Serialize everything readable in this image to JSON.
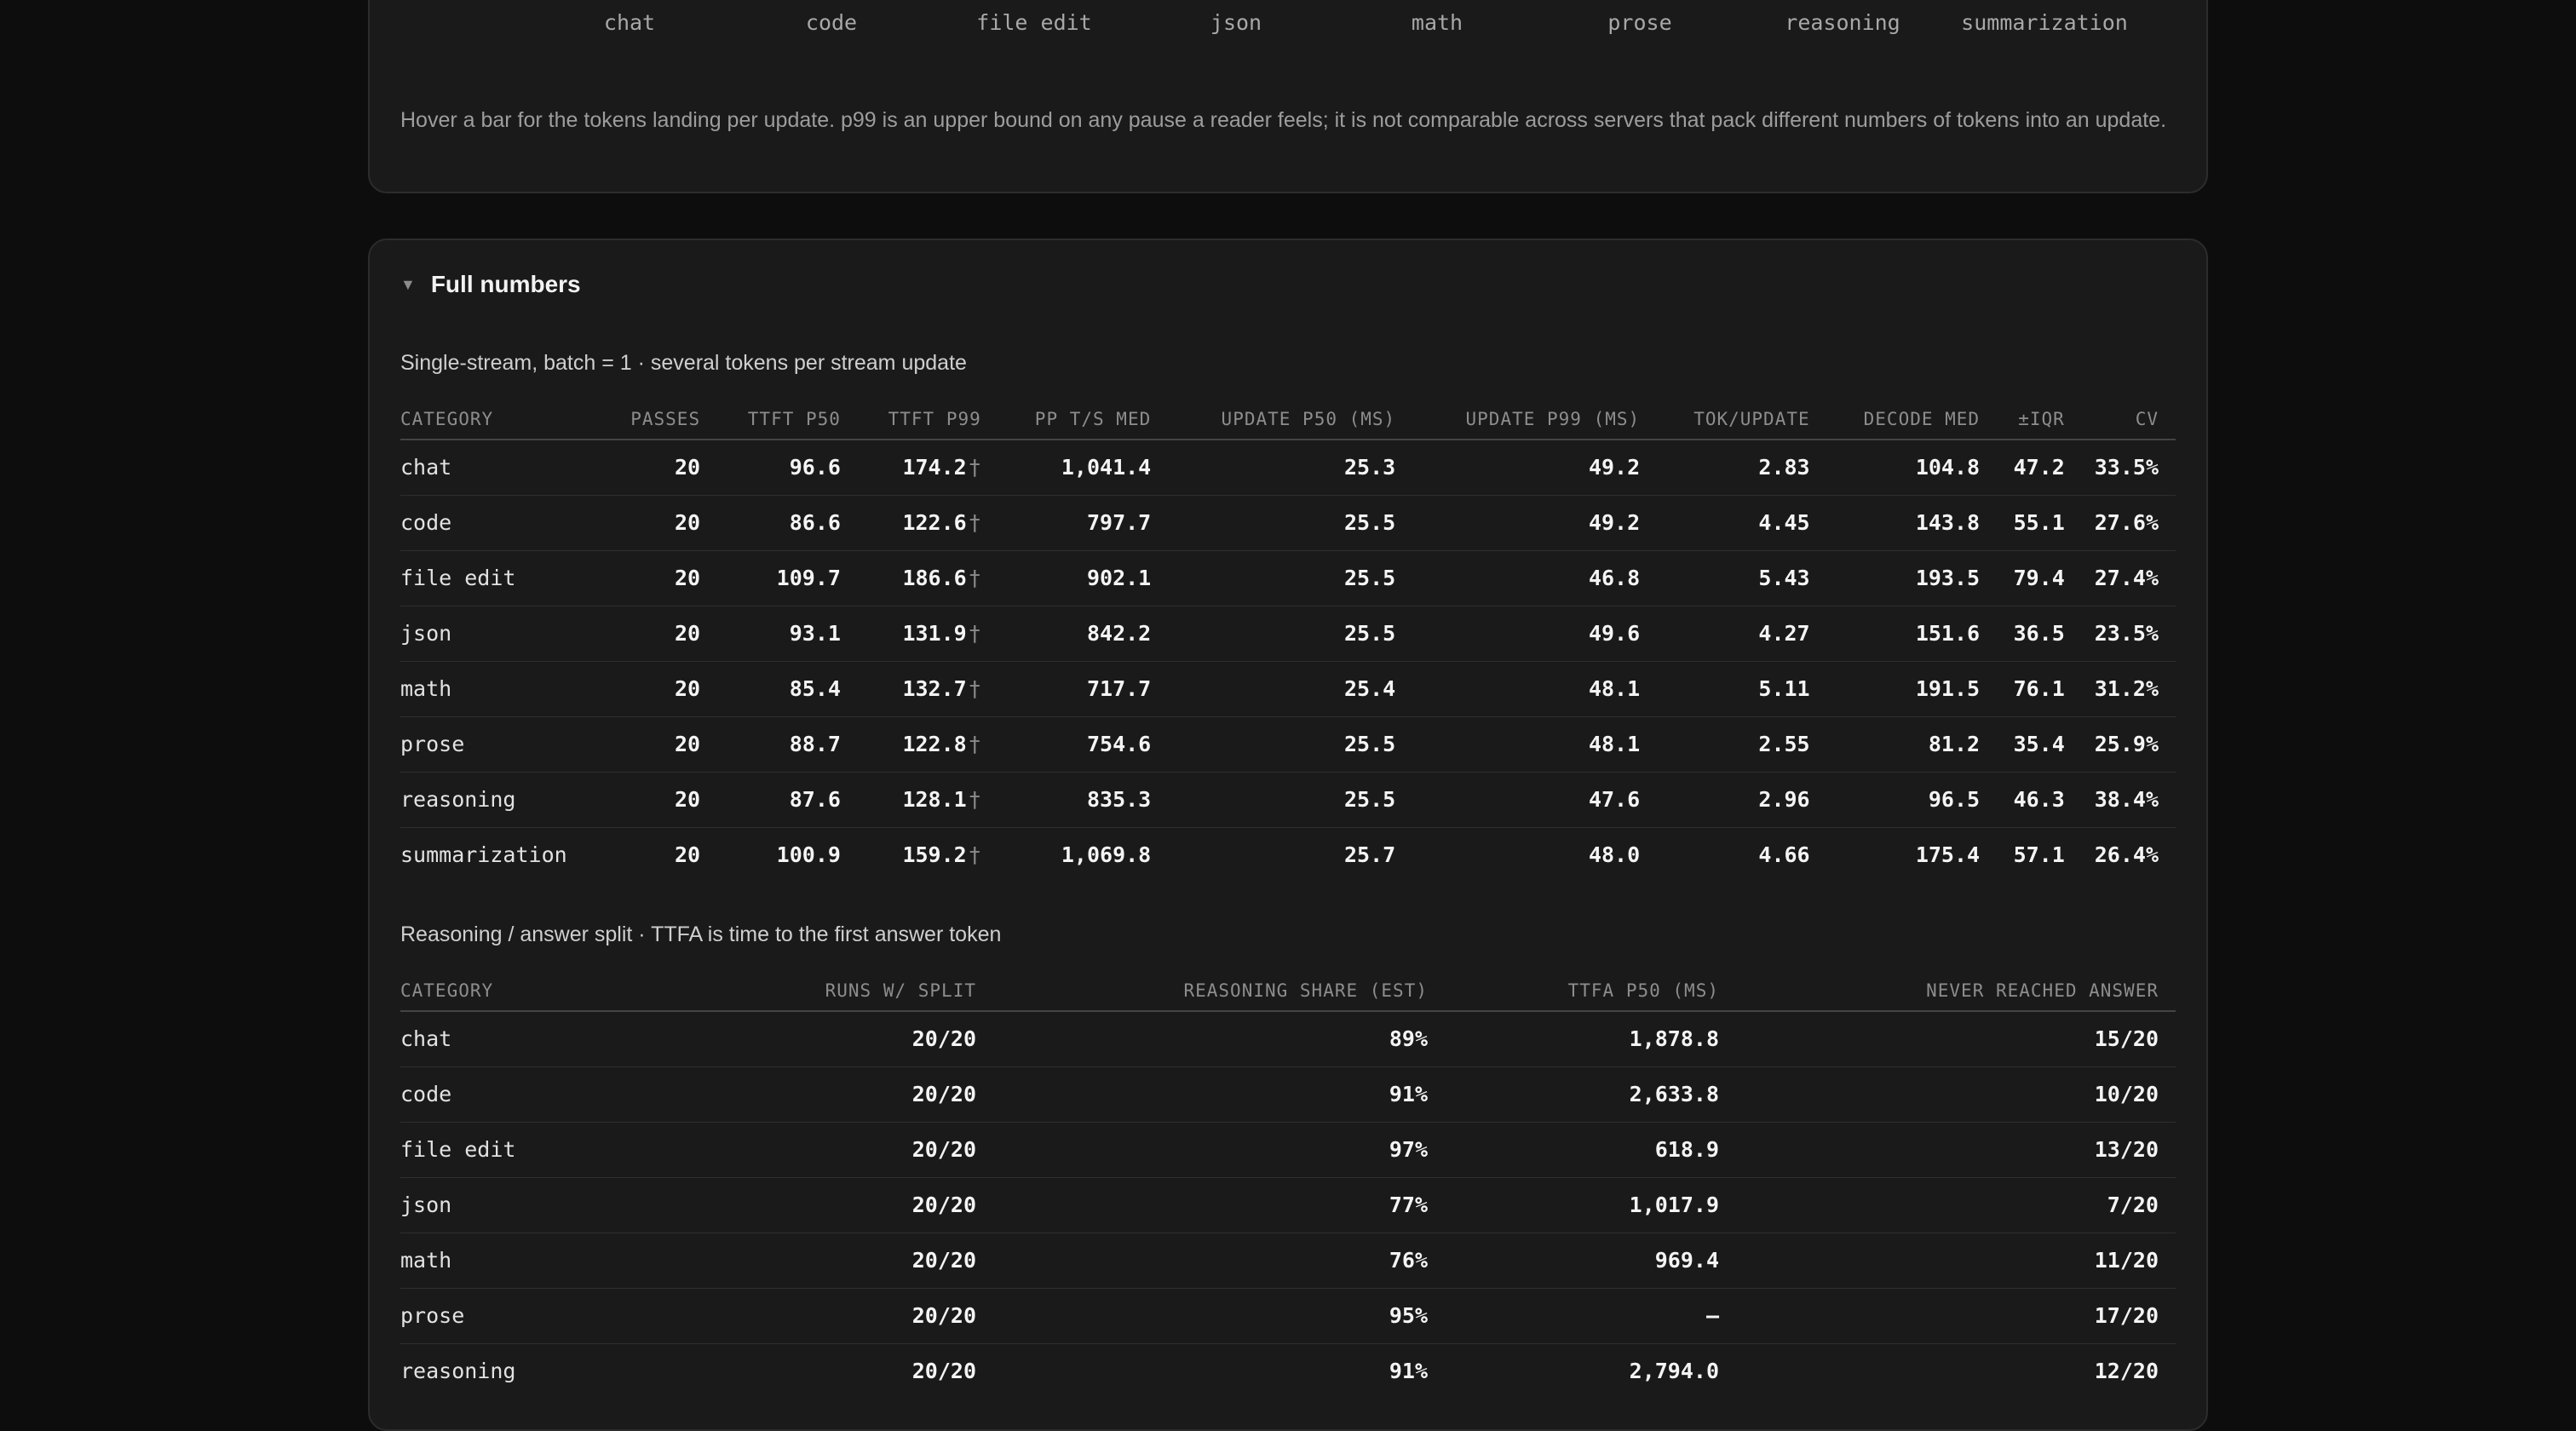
{
  "chart_labels": [
    "chat",
    "code",
    "file edit",
    "json",
    "math",
    "prose",
    "reasoning",
    "summarization"
  ],
  "note": "Hover a bar for the tokens landing per update. p99 is an upper bound on any pause a reader feels; it is not comparable across servers that pack different numbers of tokens into an update.",
  "section": {
    "title": "Full numbers",
    "toggle_icon": "▼"
  },
  "single_stream": {
    "caption": "Single-stream, batch = 1 · several tokens per stream update",
    "headers": [
      "CATEGORY",
      "PASSES",
      "TTFT P50",
      "TTFT P99",
      "PP T/S MED",
      "UPDATE P50 (MS)",
      "UPDATE P99 (MS)",
      "TOK/UPDATE",
      "DECODE MED",
      "±IQR",
      "CV"
    ],
    "dagger": "†",
    "rows": [
      {
        "category": "chat",
        "passes": "20",
        "ttft_p50": "96.6",
        "ttft_p99": "174.2",
        "pp_ts_med": "1,041.4",
        "update_p50": "25.3",
        "update_p99": "49.2",
        "tok_update": "2.83",
        "decode_med": "104.8",
        "iqr": "47.2",
        "cv": "33.5%"
      },
      {
        "category": "code",
        "passes": "20",
        "ttft_p50": "86.6",
        "ttft_p99": "122.6",
        "pp_ts_med": "797.7",
        "update_p50": "25.5",
        "update_p99": "49.2",
        "tok_update": "4.45",
        "decode_med": "143.8",
        "iqr": "55.1",
        "cv": "27.6%"
      },
      {
        "category": "file edit",
        "passes": "20",
        "ttft_p50": "109.7",
        "ttft_p99": "186.6",
        "pp_ts_med": "902.1",
        "update_p50": "25.5",
        "update_p99": "46.8",
        "tok_update": "5.43",
        "decode_med": "193.5",
        "iqr": "79.4",
        "cv": "27.4%"
      },
      {
        "category": "json",
        "passes": "20",
        "ttft_p50": "93.1",
        "ttft_p99": "131.9",
        "pp_ts_med": "842.2",
        "update_p50": "25.5",
        "update_p99": "49.6",
        "tok_update": "4.27",
        "decode_med": "151.6",
        "iqr": "36.5",
        "cv": "23.5%"
      },
      {
        "category": "math",
        "passes": "20",
        "ttft_p50": "85.4",
        "ttft_p99": "132.7",
        "pp_ts_med": "717.7",
        "update_p50": "25.4",
        "update_p99": "48.1",
        "tok_update": "5.11",
        "decode_med": "191.5",
        "iqr": "76.1",
        "cv": "31.2%"
      },
      {
        "category": "prose",
        "passes": "20",
        "ttft_p50": "88.7",
        "ttft_p99": "122.8",
        "pp_ts_med": "754.6",
        "update_p50": "25.5",
        "update_p99": "48.1",
        "tok_update": "2.55",
        "decode_med": "81.2",
        "iqr": "35.4",
        "cv": "25.9%"
      },
      {
        "category": "reasoning",
        "passes": "20",
        "ttft_p50": "87.6",
        "ttft_p99": "128.1",
        "pp_ts_med": "835.3",
        "update_p50": "25.5",
        "update_p99": "47.6",
        "tok_update": "2.96",
        "decode_med": "96.5",
        "iqr": "46.3",
        "cv": "38.4%"
      },
      {
        "category": "summarization",
        "passes": "20",
        "ttft_p50": "100.9",
        "ttft_p99": "159.2",
        "pp_ts_med": "1,069.8",
        "update_p50": "25.7",
        "update_p99": "48.0",
        "tok_update": "4.66",
        "decode_med": "175.4",
        "iqr": "57.1",
        "cv": "26.4%"
      }
    ]
  },
  "reasoning_split": {
    "caption": "Reasoning / answer split · TTFA is time to the first answer token",
    "headers": [
      "CATEGORY",
      "RUNS W/ SPLIT",
      "REASONING SHARE (EST)",
      "TTFA P50 (MS)",
      "NEVER REACHED ANSWER"
    ],
    "rows": [
      {
        "category": "chat",
        "runs": "20/20",
        "share": "89%",
        "ttfa": "1,878.8",
        "never": "15/20"
      },
      {
        "category": "code",
        "runs": "20/20",
        "share": "91%",
        "ttfa": "2,633.8",
        "never": "10/20"
      },
      {
        "category": "file edit",
        "runs": "20/20",
        "share": "97%",
        "ttfa": "618.9",
        "never": "13/20"
      },
      {
        "category": "json",
        "runs": "20/20",
        "share": "77%",
        "ttfa": "1,017.9",
        "never": "7/20"
      },
      {
        "category": "math",
        "runs": "20/20",
        "share": "76%",
        "ttfa": "969.4",
        "never": "11/20"
      },
      {
        "category": "prose",
        "runs": "20/20",
        "share": "95%",
        "ttfa": "—",
        "never": "17/20"
      },
      {
        "category": "reasoning",
        "runs": "20/20",
        "share": "91%",
        "ttfa": "2,794.0",
        "never": "12/20"
      }
    ]
  }
}
